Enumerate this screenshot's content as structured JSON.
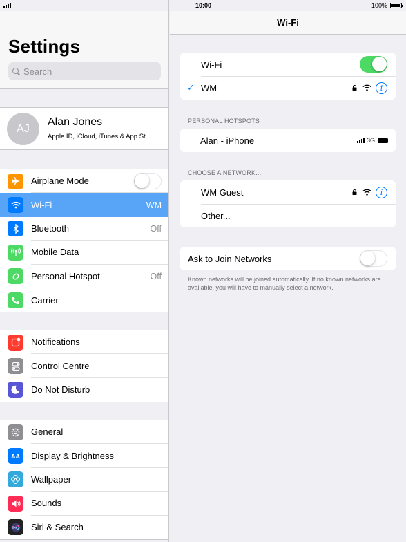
{
  "status_bar": {
    "time": "10:00",
    "battery": "100%"
  },
  "sidebar": {
    "title": "Settings",
    "search_placeholder": "Search",
    "profile": {
      "initials": "AJ",
      "name": "Alan Jones",
      "subtitle": "Apple ID, iCloud, iTunes & App St..."
    },
    "group1": [
      {
        "label": "Airplane Mode",
        "icon": "airplane-icon",
        "color": "#ff9500",
        "toggle": false
      },
      {
        "label": "Wi-Fi",
        "icon": "wifi-icon",
        "color": "#007aff",
        "value": "WM",
        "selected": true
      },
      {
        "label": "Bluetooth",
        "icon": "bluetooth-icon",
        "color": "#007aff",
        "value": "Off"
      },
      {
        "label": "Mobile Data",
        "icon": "antenna-icon",
        "color": "#4cd964"
      },
      {
        "label": "Personal Hotspot",
        "icon": "hotspot-icon",
        "color": "#4cd964",
        "value": "Off"
      },
      {
        "label": "Carrier",
        "icon": "phone-icon",
        "color": "#4cd964"
      }
    ],
    "group2": [
      {
        "label": "Notifications",
        "icon": "notifications-icon",
        "color": "#ff3b30"
      },
      {
        "label": "Control Centre",
        "icon": "control-centre-icon",
        "color": "#8e8e93"
      },
      {
        "label": "Do Not Disturb",
        "icon": "moon-icon",
        "color": "#5856d6"
      }
    ],
    "group3": [
      {
        "label": "General",
        "icon": "gear-icon",
        "color": "#8e8e93"
      },
      {
        "label": "Display & Brightness",
        "icon": "display-icon",
        "color": "#007aff"
      },
      {
        "label": "Wallpaper",
        "icon": "flower-icon",
        "color": "#34aadc"
      },
      {
        "label": "Sounds",
        "icon": "speaker-icon",
        "color": "#ff2d55"
      },
      {
        "label": "Siri & Search",
        "icon": "siri-icon",
        "color": "#222222"
      }
    ]
  },
  "detail": {
    "title": "Wi-Fi",
    "wifi_label": "Wi-Fi",
    "wifi_on": true,
    "connected_network": "WM",
    "hotspots_header": "PERSONAL HOTSPOTS",
    "hotspot": {
      "name": "Alan - iPhone",
      "network_type": "3G"
    },
    "choose_header": "CHOOSE A NETWORK...",
    "networks": [
      {
        "name": "WM Guest"
      },
      {
        "name": "Other..."
      }
    ],
    "ask_to_join": {
      "label": "Ask to Join Networks",
      "on": false
    },
    "footer": "Known networks will be joined automatically. If no known networks are available, you will have to manually select a network."
  }
}
